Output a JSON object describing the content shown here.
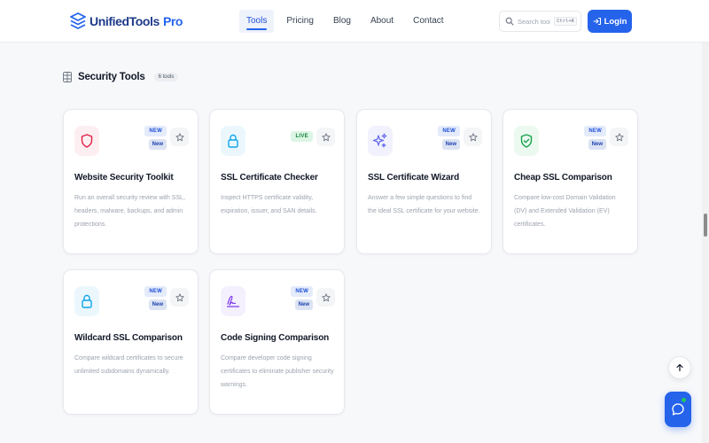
{
  "header": {
    "logo_text": "UnifiedTools",
    "logo_accent": "Pro",
    "nav": [
      {
        "label": "Tools",
        "active": true
      },
      {
        "label": "Pricing",
        "active": false
      },
      {
        "label": "Blog",
        "active": false
      },
      {
        "label": "About",
        "active": false
      },
      {
        "label": "Contact",
        "active": false
      }
    ],
    "search_placeholder": "Search tools...",
    "search_shortcut": "Ctrl+K",
    "login_label": "Login"
  },
  "section": {
    "title": "Security Tools",
    "count": "6 tools"
  },
  "cards": [
    {
      "title": "Website Security Toolkit",
      "desc": "Run an overall security review with SSL, headers, malware, backups, and admin protections.",
      "badge1": "NEW",
      "badge2": "New",
      "icon": "shield-icon"
    },
    {
      "title": "SSL Certificate Checker",
      "desc": "Inspect HTTPS certificate validity, expiration, issuer, and SAN details.",
      "badge1": "LIVE",
      "badge2": "",
      "icon": "lock-icon"
    },
    {
      "title": "SSL Certificate Wizard",
      "desc": "Answer a few simple questions to find the ideal SSL certificate for your website.",
      "badge1": "NEW",
      "badge2": "New",
      "icon": "sparkles-icon"
    },
    {
      "title": "Cheap SSL Comparison",
      "desc": "Compare low-cost Domain Validation (DV) and Extended Validation (EV) certificates.",
      "badge1": "NEW",
      "badge2": "New",
      "icon": "shield-check-icon"
    },
    {
      "title": "Wildcard SSL Comparison",
      "desc": "Compare wildcard certificates to secure unlimited subdomains dynamically.",
      "badge1": "NEW",
      "badge2": "New",
      "icon": "lock-icon"
    },
    {
      "title": "Code Signing Comparison",
      "desc": "Compare developer code signing certificates to eliminate publisher security warnings.",
      "badge1": "NEW",
      "badge2": "New",
      "icon": "signature-icon"
    }
  ],
  "colors": {
    "accent": "#2563eb",
    "shield": "#e11d48",
    "lock": "#0ea5e9",
    "sparkles": "#6366f1",
    "shield_check": "#16a34a",
    "signature": "#7c3aed"
  }
}
